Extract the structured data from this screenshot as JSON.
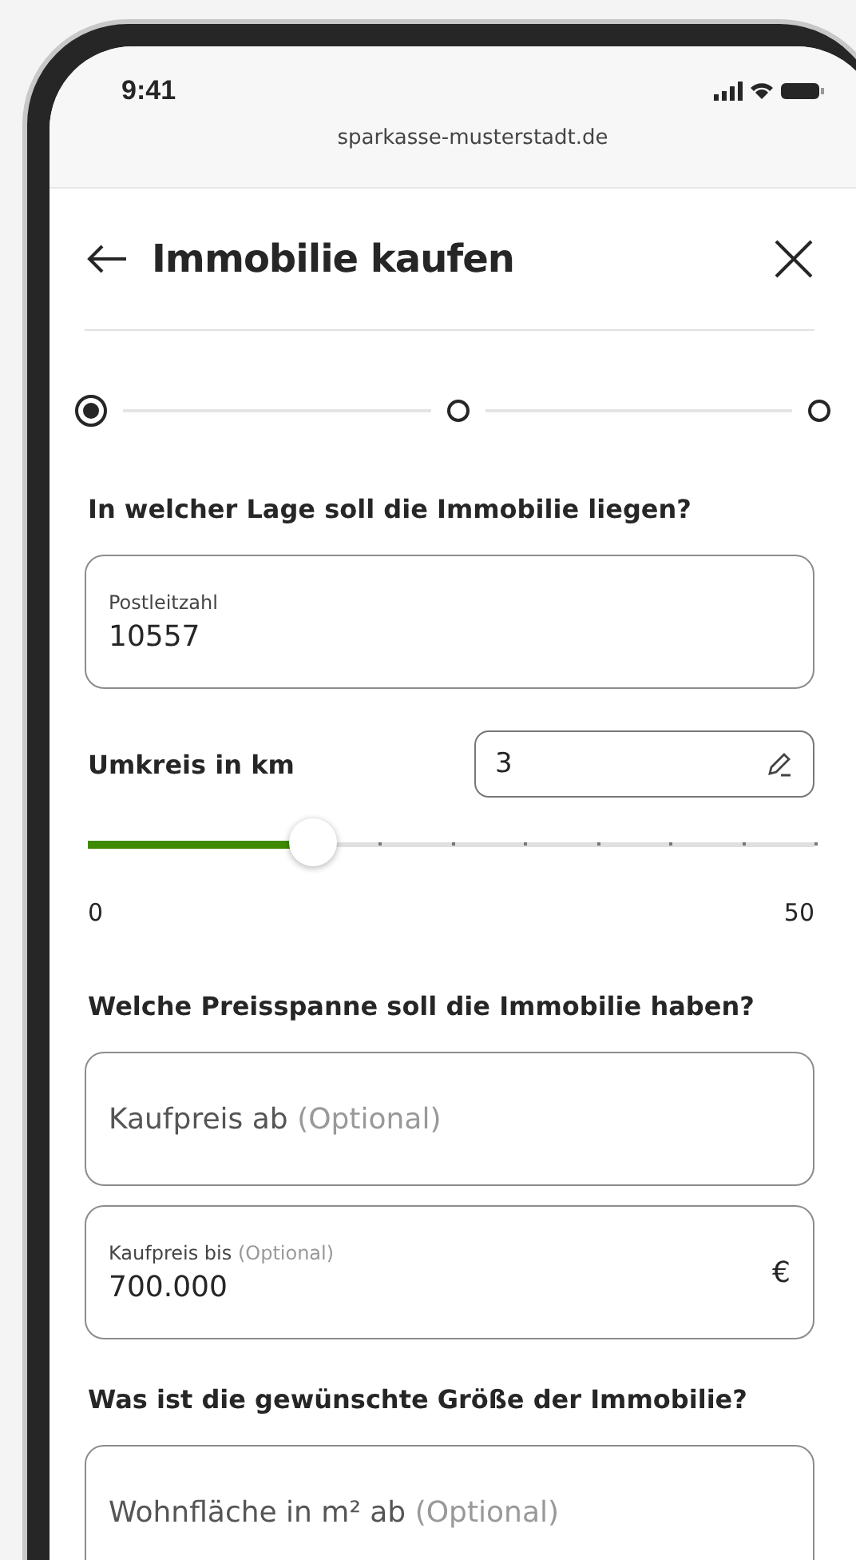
{
  "status_bar": {
    "time": "9:41"
  },
  "browser": {
    "url": "sparkasse-musterstadt.de"
  },
  "header": {
    "title": "Immobilie kaufen"
  },
  "steps": [
    {
      "selected": true
    },
    {
      "selected": false
    },
    {
      "selected": false
    }
  ],
  "sections": [
    {
      "question": "In welcher Lage soll die Immobilie liegen?",
      "fields": [
        {
          "kind": "filled",
          "label": "Postleitzahl",
          "value": "10557"
        }
      ]
    },
    {
      "kind": "slider",
      "label": "Umkreis in km",
      "value": "3",
      "level": 0.31,
      "min": "0",
      "max": "50"
    },
    {
      "question": "Welche Preisspanne soll die Immobilie haben?",
      "fields": [
        {
          "kind": "empty",
          "label": "Kaufpreis ab",
          "optional": "(Optional)"
        },
        {
          "kind": "filled",
          "label": "Kaufpreis bis",
          "optional": "(Optional)",
          "value": "700.000",
          "unit": "€"
        }
      ]
    },
    {
      "question": "Was ist die gewünschte Größe der Immobilie?",
      "fields": [
        {
          "kind": "empty",
          "label": "Wohnfläche in m² ab",
          "optional": "(Optional)"
        }
      ]
    }
  ]
}
